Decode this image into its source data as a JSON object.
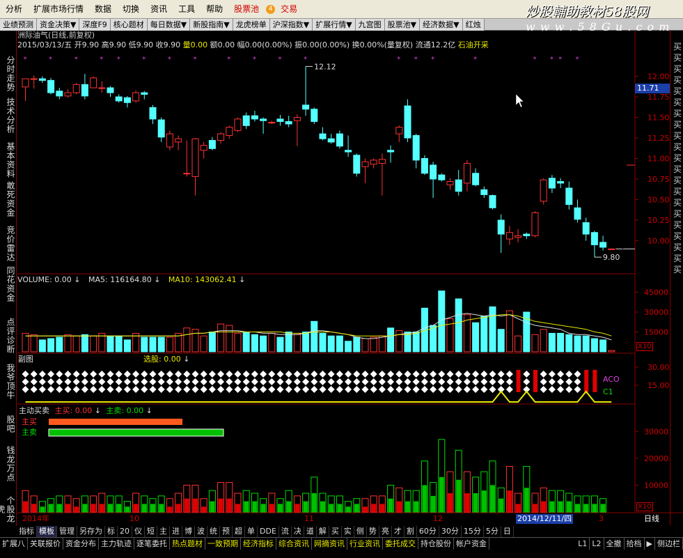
{
  "menu": [
    {
      "label": "分析"
    },
    {
      "label": "扩展市场行情"
    },
    {
      "label": "数据"
    },
    {
      "label": "切换"
    },
    {
      "label": "资讯"
    },
    {
      "label": "工具"
    },
    {
      "label": "帮助"
    },
    {
      "label": "股票池",
      "red": true,
      "badge": "4"
    },
    {
      "label": "交易",
      "red": true
    }
  ],
  "watermark": {
    "line1": "炒股輔助教材58股网",
    "line1_highlight": "58",
    "line2": "w w w . 5 8 G u . c o m"
  },
  "toolbar": [
    "业绩预测",
    "资金决策▼",
    "深度F9",
    "核心题材",
    "每日数据▼",
    "新股指南▼",
    "龙虎榜单",
    "沪深指数▼",
    "扩展行情▼",
    "九宫图",
    "股票池▼",
    "经济数据▼",
    "红烛"
  ],
  "left_tabs": [
    "分时走势",
    "技术分析",
    "基本资料",
    "敢死资金",
    "竞价雷达",
    "同花资金",
    "点评诊断",
    "我爷顶牛",
    "股吧",
    "钱龙万点",
    "个股龙虎"
  ],
  "right_tabs": [
    "买",
    "买",
    "买",
    "买",
    "买",
    "买",
    "买",
    "买",
    "买",
    "买",
    "买",
    "买",
    "买",
    "买",
    "买",
    "买",
    "买",
    "买",
    "买",
    "买",
    "买"
  ],
  "info": {
    "title": "洲际油气(日线,前复权)",
    "date": "2015/03/13/五",
    "open": "开9.90",
    "high": "高9.90",
    "low": "低9.90",
    "close": "收9.90",
    "vol": "量0.00",
    "amount": "额0.00",
    "range": "幅0.00(0.00%)",
    "swing": "振0.00(0.00%)",
    "turnover": "换0.00%(量复权)",
    "float": "流通12.2亿",
    "concept": "石油开采"
  },
  "price_panel": {
    "yticks": [
      "12.00",
      "11.75",
      "11.50",
      "11.25",
      "11.00",
      "10.75",
      "10.50",
      "10.25",
      "10.00"
    ],
    "hi_label": "12.12",
    "lo_label": "9.80",
    "current_price": "11.71"
  },
  "volume_panel": {
    "label": "VOLUME: 0.00",
    "ma5": "MA5: 116164.80",
    "ma10": "MA10: 143062.41",
    "yticks": [
      "45000",
      "30000",
      "15000"
    ],
    "multiplier": "X10"
  },
  "sub_panel": {
    "title": "副图",
    "pick": "选股: 0.00",
    "yticks": [
      "30.00",
      "15.00"
    ],
    "legend1": "ACO",
    "legend2": "C1"
  },
  "flow_panel": {
    "title": "主动买卖",
    "buy": "主买: 0.00",
    "sell": "主卖: 0.00",
    "buy_label": "主买",
    "sell_label": "主卖",
    "yticks": [
      "30000",
      "20000",
      "10000"
    ],
    "multiplier": "X10"
  },
  "xaxis": {
    "labels": [
      "2014年",
      "10",
      "11",
      "12",
      "3"
    ],
    "cursor_date": "2014/12/11/四",
    "period": "日线"
  },
  "bottom_tabs": [
    "指标",
    "模板",
    "管理",
    "另存为",
    "标",
    "20",
    "仪",
    "短",
    "主",
    "进",
    "博",
    "波",
    "统",
    "预",
    "超",
    "单",
    "DDE",
    "流",
    "决",
    "道",
    "解",
    "买",
    "实",
    "侧",
    "势",
    "亮",
    "才",
    "割",
    "60分",
    "30分",
    "15分",
    "5分",
    "日"
  ],
  "status_tabs": [
    "扩展八",
    "关联报价",
    "资金分布",
    "主力轨迹",
    "逐笔委托",
    "热点题材",
    "一致预期",
    "经济指标",
    "综合资讯",
    "网摘资讯",
    "行业资讯",
    "委托成交",
    "持仓股份",
    "帐户资金",
    "L1",
    "L2",
    "全撤",
    "拾档",
    "▶",
    "侧边栏"
  ],
  "chart_data": {
    "type": "candlestick",
    "candles": [
      [
        11.87,
        11.97,
        11.7,
        11.97
      ],
      [
        11.97,
        12.01,
        11.85,
        11.97
      ],
      [
        11.97,
        12.0,
        11.92,
        11.95
      ],
      [
        11.95,
        11.98,
        11.78,
        11.8
      ],
      [
        11.82,
        11.86,
        11.72,
        11.76
      ],
      [
        11.76,
        11.84,
        11.74,
        11.8
      ],
      [
        11.8,
        11.92,
        11.78,
        11.9
      ],
      [
        11.9,
        12.03,
        11.72,
        11.76
      ],
      [
        11.86,
        12.0,
        11.86,
        11.98
      ],
      [
        11.86,
        11.94,
        11.8,
        11.86
      ],
      [
        11.86,
        11.88,
        11.75,
        11.8
      ],
      [
        11.75,
        11.78,
        11.68,
        11.7
      ],
      [
        11.74,
        11.76,
        11.62,
        11.68
      ],
      [
        11.7,
        11.83,
        11.68,
        11.8
      ],
      [
        11.8,
        11.82,
        11.72,
        11.78
      ],
      [
        11.62,
        11.65,
        11.42,
        11.48
      ],
      [
        11.47,
        11.5,
        11.2,
        11.26
      ],
      [
        11.14,
        11.34,
        11.1,
        11.3
      ],
      [
        11.2,
        11.28,
        11.1,
        11.24
      ],
      [
        10.82,
        11.22,
        10.78,
        10.82
      ],
      [
        10.78,
        11.25,
        10.55,
        11.24
      ],
      [
        11.1,
        11.2,
        11.0,
        11.16
      ],
      [
        11.22,
        11.26,
        11.1,
        11.12
      ],
      [
        11.22,
        11.32,
        11.18,
        11.3
      ],
      [
        11.28,
        11.4,
        11.24,
        11.38
      ],
      [
        11.34,
        11.5,
        11.32,
        11.48
      ],
      [
        11.52,
        11.56,
        11.36,
        11.4
      ],
      [
        11.52,
        11.58,
        11.45,
        11.48
      ],
      [
        11.48,
        11.5,
        11.3,
        11.46
      ],
      [
        11.44,
        11.46,
        11.42,
        11.44
      ],
      [
        11.48,
        11.53,
        11.4,
        11.45
      ],
      [
        11.45,
        11.52,
        11.38,
        11.42
      ],
      [
        11.46,
        11.54,
        11.15,
        11.5
      ],
      [
        11.65,
        12.12,
        11.52,
        11.6
      ],
      [
        11.6,
        11.62,
        11.42,
        11.45
      ],
      [
        11.3,
        11.38,
        11.22,
        11.24
      ],
      [
        11.24,
        11.3,
        11.18,
        11.2
      ],
      [
        11.3,
        11.34,
        11.12,
        11.15
      ],
      [
        11.1,
        11.28,
        11.02,
        11.08
      ],
      [
        11.04,
        11.06,
        10.78,
        10.82
      ],
      [
        10.9,
        11.0,
        10.7,
        10.96
      ],
      [
        10.93,
        11.0,
        10.88,
        10.98
      ],
      [
        10.94,
        11.06,
        10.55,
        10.99
      ],
      [
        11.1,
        11.16,
        10.95,
        11.08
      ],
      [
        11.3,
        11.4,
        11.2,
        11.38
      ],
      [
        11.64,
        11.72,
        11.2,
        11.25
      ],
      [
        11.28,
        11.3,
        10.88,
        10.98
      ],
      [
        11.0,
        11.04,
        10.8,
        10.82
      ],
      [
        10.92,
        10.96,
        10.52,
        10.75
      ],
      [
        10.8,
        10.82,
        10.72,
        10.74
      ],
      [
        10.68,
        10.76,
        10.62,
        10.72
      ],
      [
        10.74,
        10.86,
        10.55,
        10.6
      ],
      [
        10.7,
        10.98,
        10.6,
        10.94
      ],
      [
        10.82,
        10.88,
        10.66,
        10.68
      ],
      [
        10.62,
        10.66,
        10.52,
        10.56
      ],
      [
        10.55,
        10.56,
        10.38,
        10.4
      ],
      [
        10.25,
        10.32,
        9.85,
        10.08
      ],
      [
        10.02,
        10.18,
        9.95,
        10.1
      ],
      [
        10.04,
        10.14,
        9.98,
        10.06
      ],
      [
        10.08,
        10.1,
        10.02,
        10.06
      ],
      [
        10.06,
        10.36,
        10.04,
        10.34
      ],
      [
        10.48,
        10.76,
        10.44,
        10.74
      ],
      [
        10.76,
        10.8,
        10.58,
        10.64
      ],
      [
        10.72,
        10.76,
        10.64,
        10.7
      ],
      [
        10.64,
        10.72,
        10.38,
        10.44
      ],
      [
        10.4,
        10.5,
        10.22,
        10.26
      ],
      [
        10.22,
        10.28,
        10.0,
        10.08
      ],
      [
        10.1,
        10.12,
        9.8,
        9.95
      ],
      [
        9.98,
        10.06,
        9.88,
        9.92
      ],
      [
        9.9,
        9.9,
        9.9,
        9.9
      ]
    ],
    "volumes": [
      14,
      13,
      9,
      10,
      11,
      13,
      12,
      13,
      12,
      14,
      12,
      12,
      9,
      14,
      11,
      11,
      11,
      11,
      14,
      18,
      17,
      12,
      15,
      21,
      20,
      14,
      15,
      13,
      12,
      14,
      11,
      15,
      13,
      15,
      23,
      14,
      12,
      12,
      8,
      11,
      10,
      11,
      12,
      18,
      16,
      15,
      15,
      33,
      20,
      46,
      25,
      40,
      28,
      22,
      27,
      34,
      17,
      31,
      12,
      30,
      13,
      17,
      14,
      14,
      13,
      12,
      12,
      10,
      9,
      1
    ],
    "ma5": [
      12,
      12,
      12,
      12,
      12,
      12,
      12,
      12,
      12,
      12,
      12,
      12,
      12,
      12,
      12,
      12,
      12,
      12,
      12,
      13,
      14,
      14,
      15,
      16,
      16,
      16,
      15,
      15,
      14,
      14,
      13,
      13,
      13,
      14,
      16,
      16,
      15,
      14,
      13,
      11,
      10,
      10,
      11,
      12,
      13,
      14,
      15,
      18,
      20,
      24,
      26,
      28,
      29,
      28,
      27,
      28,
      27,
      28,
      25,
      22,
      20,
      19,
      18,
      17,
      14,
      13,
      13,
      12,
      11,
      9
    ],
    "ma10": [
      12,
      12,
      12,
      12,
      12,
      12,
      12,
      12,
      12,
      12,
      12,
      12,
      12,
      12,
      12,
      12,
      12,
      12,
      12,
      13,
      14,
      14,
      15,
      15,
      15,
      15,
      15,
      15,
      15,
      15,
      15,
      14,
      14,
      14,
      15,
      15,
      15,
      14,
      13,
      12,
      12,
      12,
      12,
      12,
      13,
      13,
      14,
      16,
      18,
      20,
      21,
      22,
      24,
      25,
      26,
      27,
      28,
      28,
      27,
      25,
      23,
      22,
      21,
      20,
      19,
      18,
      17,
      15,
      14,
      12
    ],
    "flow_buy": [
      4,
      3,
      2,
      2,
      3,
      3,
      2,
      3,
      3,
      3,
      3,
      3,
      2,
      3,
      3,
      2,
      3,
      2,
      3,
      5,
      5,
      2,
      4,
      5,
      5,
      3,
      4,
      3,
      2,
      3,
      2,
      4,
      3,
      3,
      6,
      3,
      3,
      3,
      2,
      2,
      2,
      3,
      3,
      5,
      4,
      4,
      4,
      9,
      5,
      14,
      7,
      11,
      7,
      6,
      7,
      9,
      4,
      8,
      3,
      8,
      3,
      4,
      4,
      4,
      3,
      3,
      3,
      3,
      2,
      0
    ],
    "flow_sell": [
      4,
      3,
      2,
      3,
      3,
      3,
      3,
      3,
      3,
      4,
      3,
      3,
      2,
      4,
      3,
      3,
      3,
      3,
      4,
      5,
      5,
      3,
      4,
      6,
      6,
      4,
      4,
      4,
      3,
      4,
      3,
      4,
      3,
      4,
      7,
      4,
      3,
      3,
      2,
      3,
      3,
      3,
      3,
      5,
      5,
      4,
      4,
      10,
      6,
      13,
      8,
      12,
      8,
      7,
      8,
      10,
      5,
      9,
      4,
      9,
      4,
      5,
      4,
      4,
      4,
      3,
      3,
      3,
      3,
      0
    ],
    "signal_marks": [
      0,
      3,
      6,
      9,
      11,
      14,
      17,
      20,
      24,
      27,
      30,
      33,
      44,
      46,
      48,
      53,
      60,
      62,
      63,
      65
    ],
    "red_bars": [
      58,
      60,
      66,
      67
    ],
    "ylim_price": [
      9.75,
      12.25
    ],
    "ylim_vol": [
      0,
      50
    ]
  }
}
